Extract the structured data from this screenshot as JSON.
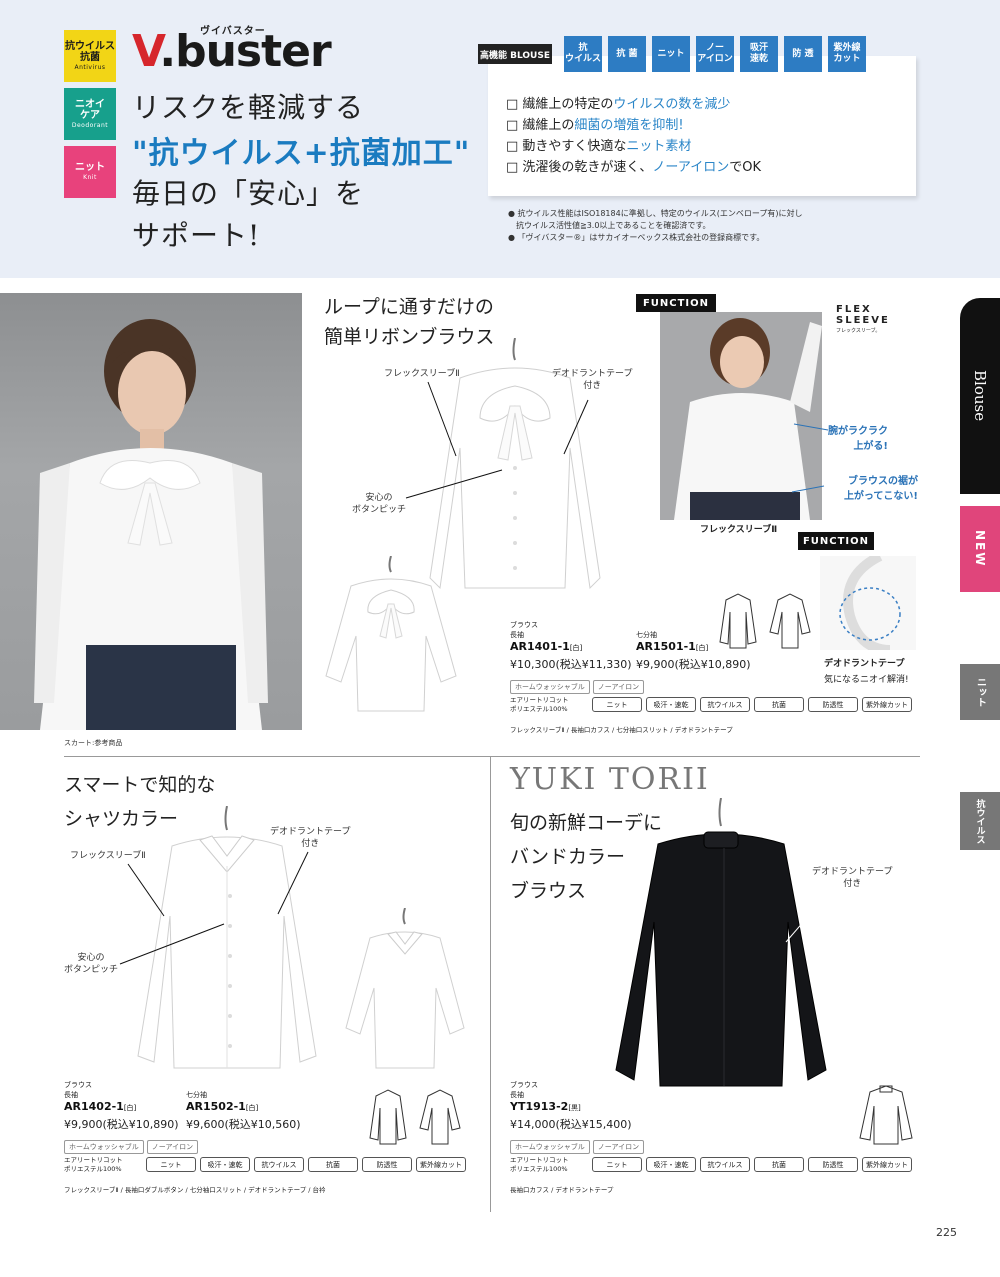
{
  "header": {
    "badges": [
      {
        "main": "抗ウイルス\n抗菌",
        "sub": "Antivirus",
        "bg": "#f2d516",
        "fg": "#1a1a1a"
      },
      {
        "main": "ニオイ\nケア",
        "sub": "Deodorant",
        "bg": "#17a08c",
        "fg": "#ffffff"
      },
      {
        "main": "ニット",
        "sub": "Knit",
        "bg": "#e8427c",
        "fg": "#ffffff"
      }
    ],
    "logo_v": "V",
    "logo_rest": ".buster",
    "logo_ruby": "ヴイバスター",
    "headline_1": "リスクを軽減する",
    "headline_2": "\"抗ウイルス+抗菌加工\"",
    "headline_3": "毎日の「安心」を",
    "headline_4": "サポート!",
    "spec_tag": "高機能 BLOUSE",
    "features": [
      "抗\nウイルス",
      "抗 菌",
      "ニット",
      "ノー\nアイロン",
      "吸汗\n速乾",
      "防 透",
      "紫外線\nカット"
    ],
    "checks": [
      {
        "pre": "□ 繊維上の特定の",
        "em": "ウイルスの数を減少",
        "post": ""
      },
      {
        "pre": "□ 繊維上の",
        "em": "細菌の増殖を抑制!",
        "post": ""
      },
      {
        "pre": "□ 動きやすく快適な",
        "em": "ニット素材",
        "post": ""
      },
      {
        "pre": "□ 洗濯後の乾きが速く、",
        "em": "ノーアイロン",
        "post": "でOK"
      }
    ],
    "notes": [
      "● 抗ウイルス性能はISO18184に準拠し、特定のウイルス(エンベロープ有)に対し",
      "　抗ウイルス活性値≧3.0以上であることを確認済です。",
      "● 「ヴイバスター®」はサカイオーベックス株式会社の登録商標です。"
    ],
    "accent_blue": "#2d7cc3"
  },
  "section1": {
    "title_1": "ループに通すだけの",
    "title_2": "簡単リボンブラウス",
    "caption_model": "スカート:参考商品",
    "callout_flex": "フレックスリーブⅡ",
    "callout_deo_1": "デオドラントテープ",
    "callout_deo_2": "付き",
    "callout_btn_1": "安心の",
    "callout_btn_2": "ボタンピッチ",
    "function_tag": "FUNCTION",
    "flex_logo_1": "FLEX",
    "flex_logo_2": "SLEEVE",
    "flex_logo_3": "フレックスリーブ。",
    "note_arm_1": "腕がラクラク",
    "note_arm_2": "上がる!",
    "note_hem_1": "ブラウスの裾が",
    "note_hem_2": "上がってこない!",
    "flex_caption": "フレックスリーブⅡ",
    "function_tag_2": "FUNCTION",
    "deo_title": "デオドラントテープ",
    "deo_sub": "気になるニオイ解消!",
    "cat_1": "ブラウス",
    "sleeve_long": "長袖",
    "code_1": "AR1401-1",
    "color_1": "[白]",
    "price_1": "¥10,300(税込¥11,330)",
    "sleeve_7": "七分袖",
    "code_2": "AR1501-1",
    "color_2": "[白]",
    "price_2": "¥9,900(税込¥10,890)",
    "chip_1": "ホームウォッシャブル",
    "chip_2": "ノーアイロン",
    "fabric_1": "エアリートリコット",
    "fabric_2": "ポリエステル100%",
    "specs": [
      "ニット",
      "吸汗・速乾",
      "抗ウイルス",
      "抗菌",
      "防透性",
      "紫外線カット"
    ],
    "details": "フレックスリーブⅡ / 長袖口カフス / 七分袖口スリット / デオドラントテープ"
  },
  "section2": {
    "title_1": "スマートで知的な",
    "title_2": "シャツカラー",
    "callout_flex": "フレックスリーブⅡ",
    "callout_deo_1": "デオドラントテープ",
    "callout_deo_2": "付き",
    "callout_btn_1": "安心の",
    "callout_btn_2": "ボタンピッチ",
    "cat": "ブラウス",
    "sleeve_long": "長袖",
    "code_1": "AR1402-1",
    "color_1": "[白]",
    "price_1": "¥9,900(税込¥10,890)",
    "sleeve_7": "七分袖",
    "code_2": "AR1502-1",
    "color_2": "[白]",
    "price_2": "¥9,600(税込¥10,560)",
    "chip_1": "ホームウォッシャブル",
    "chip_2": "ノーアイロン",
    "fabric_1": "エアリートリコット",
    "fabric_2": "ポリエステル100%",
    "specs": [
      "ニット",
      "吸汗・速乾",
      "抗ウイルス",
      "抗菌",
      "防透性",
      "紫外線カット"
    ],
    "details": "フレックスリーブⅡ / 長袖口ダブルボタン / 七分袖口スリット / デオドラントテープ / 台衿"
  },
  "section3": {
    "brand": "YUKI TORII",
    "title_1": "旬の新鮮コーデに",
    "title_2": "バンドカラー",
    "title_3": "ブラウス",
    "callout_deo_1": "デオドラントテープ",
    "callout_deo_2": "付き",
    "cat": "ブラウス",
    "sleeve_long": "長袖",
    "code": "YT1913-2",
    "color": "[黒]",
    "price": "¥14,000(税込¥15,400)",
    "chip_1": "ホームウォッシャブル",
    "chip_2": "ノーアイロン",
    "fabric_1": "エアリートリコット",
    "fabric_2": "ポリエステル100%",
    "specs": [
      "ニット",
      "吸汗・速乾",
      "抗ウイルス",
      "抗菌",
      "防透性",
      "紫外線カット"
    ],
    "details": "長袖口カフス / デオドラントテープ"
  },
  "tabs": {
    "blouse": "Blouse",
    "new": "NEW",
    "knit": "ニット",
    "antivirus": "抗ウイルス"
  },
  "page_number": "225"
}
